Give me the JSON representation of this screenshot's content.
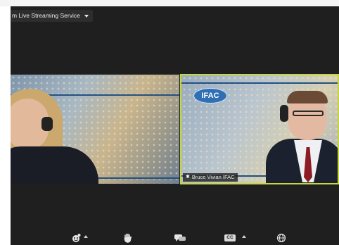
{
  "stream": {
    "label": "m Live Streaming Service"
  },
  "participants": [
    {
      "name": ""
    },
    {
      "name": "Bruce Vivian IFAC",
      "logo_text": "IFAC"
    }
  ],
  "toolbar": {
    "cc_label": "CC",
    "icons": [
      "video-icon",
      "reactions-icon",
      "raise-hand-icon",
      "chat-icon",
      "captions-icon",
      "globe-icon"
    ]
  },
  "colors": {
    "active_speaker_border": "#c8d63a",
    "background": "#1f1f1f"
  }
}
